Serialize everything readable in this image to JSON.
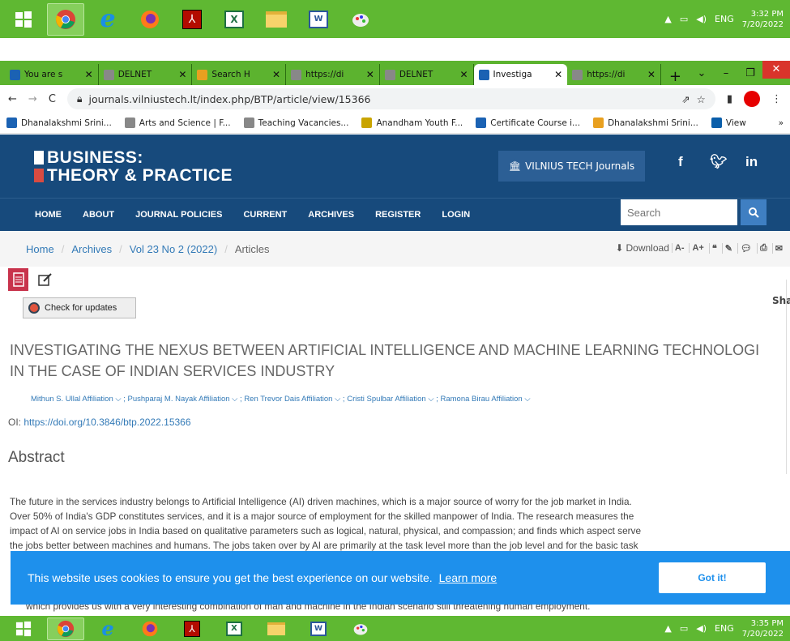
{
  "taskbar_top": {
    "icons": [
      "windows-start-icon",
      "chrome-icon",
      "internet-explorer-icon",
      "firefox-icon",
      "acrobat-icon",
      "excel-icon",
      "file-explorer-icon",
      "word-icon",
      "paint-icon"
    ],
    "lang": "ENG",
    "time": "3:32 PM",
    "date": "7/20/2022"
  },
  "taskbar_bottom": {
    "lang": "ENG",
    "time": "3:35 PM",
    "date": "7/20/2022"
  },
  "tabs": [
    {
      "label": "You are s",
      "color": "#1b62b3"
    },
    {
      "label": "DELNET",
      "color": "#888"
    },
    {
      "label": "Search H",
      "color": "#e8a020"
    },
    {
      "label": "https://di",
      "color": "#888"
    },
    {
      "label": "DELNET",
      "color": "#888"
    },
    {
      "label": "Investiga",
      "color": "#1b62b3"
    },
    {
      "label": "https://di",
      "color": "#888"
    }
  ],
  "url": "journals.vilniustech.lt/index.php/BTP/article/view/15366",
  "bookmarks": [
    {
      "label": "Dhanalakshmi Srini...",
      "color": "#1b62b3"
    },
    {
      "label": "Arts and Science | F...",
      "color": "#888"
    },
    {
      "label": "Teaching Vacancies...",
      "color": "#888"
    },
    {
      "label": "Anandham Youth F...",
      "color": "#c9a400"
    },
    {
      "label": "Certificate Course i...",
      "color": "#1b62b3"
    },
    {
      "label": "Dhanalakshmi Srini...",
      "color": "#e8a020"
    },
    {
      "label": "View",
      "color": "#0a5eaa"
    }
  ],
  "header": {
    "logo_line1": "BUSINESS:",
    "logo_line2": "THEORY & PRACTICE",
    "vt_button": "VILNIUS TECH Journals"
  },
  "nav": [
    "HOME",
    "ABOUT",
    "JOURNAL POLICIES",
    "CURRENT",
    "ARCHIVES",
    "REGISTER",
    "LOGIN"
  ],
  "search": {
    "placeholder": "Search"
  },
  "breadcrumb": [
    "Home",
    "Archives",
    "Vol 23 No 2 (2022)",
    "Articles"
  ],
  "tools": {
    "download": "Download",
    "a_minus": "A-",
    "a_plus": "A+"
  },
  "check_updates": "Check for updates",
  "share": "Sha",
  "title_line1": "INVESTIGATING THE NEXUS BETWEEN ARTIFICIAL INTELLIGENCE AND MACHINE LEARNING TECHNOLOGI",
  "title_line2": "IN THE CASE OF INDIAN SERVICES INDUSTRY",
  "authors": [
    "Mithun S. Ullal Affiliation",
    "Pushparaj M. Nayak Affiliation",
    "Ren Trevor Dais Affiliation",
    "Cristi Spulbar Affiliation",
    "Ramona Birau Affiliation"
  ],
  "doi_label": "OI:",
  "doi_link": "https://doi.org/10.3846/btp.2022.15366",
  "abstract_heading": "Abstract",
  "abstract_lines": [
    "The future in the services industry belongs to Artificial Intelligence (AI) driven machines, which is a major source of worry for the job market in India.",
    "Over 50% of India's GDP constitutes services, and it is a major source of employment for the skilled manpower of India. The research measures the",
    "impact of AI on service jobs in India based on qualitative parameters such as logical, natural, physical, and compassion; and finds which aspect serve",
    "the jobs better between machines and humans. The jobs taken over by AI are primarily at the task level more than the job level and for the basic task"
  ],
  "abstract_tail": "which provides us with a very interesting combination of man and machine in the Indian scenario still threatening human employment.",
  "cookie": {
    "text": "This website uses cookies to ensure you get the best experience on our website.",
    "learn_more": "Learn more",
    "button": "Got it!"
  }
}
